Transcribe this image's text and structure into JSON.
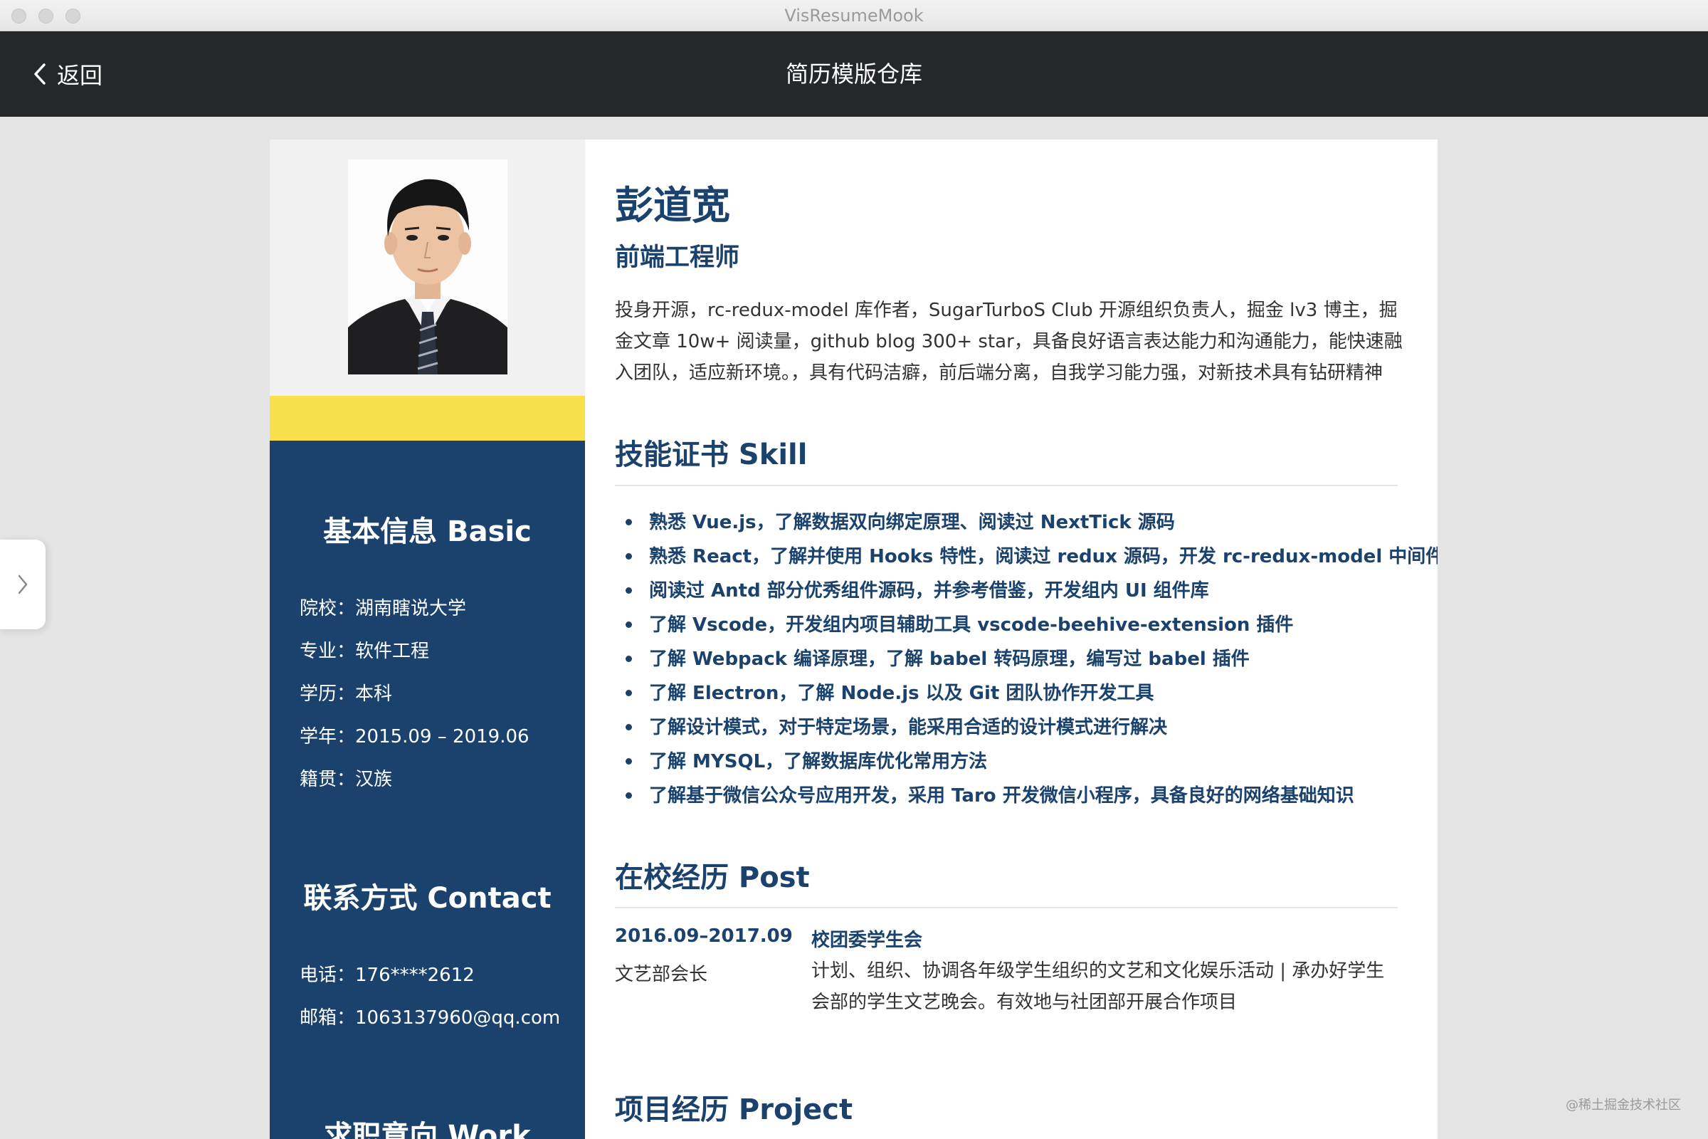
{
  "window": {
    "title": "VisResumeMook"
  },
  "header": {
    "back_label": "返回",
    "title": "简历模版仓库"
  },
  "resume": {
    "name": "彭道宽",
    "job_title": "前端工程师",
    "intro": "投身开源，rc-redux-model 库作者，SugarTurboS Club 开源组织负责人，掘金 lv3 博主，掘金文章 10w+ 阅读量，github blog 300+ star，具备良好语言表达能力和沟通能力，能快速融入团队，适应新环境。，具有代码洁癖，前后端分离，自我学习能力强，对新技术具有钻研精神",
    "basic": {
      "heading": "基本信息 Basic",
      "rows": [
        {
          "text": "院校：湖南瞎说大学"
        },
        {
          "text": "专业：软件工程"
        },
        {
          "text": "学历：本科"
        },
        {
          "text": "学年：2015.09 – 2019.06"
        },
        {
          "text": "籍贯：汉族"
        }
      ]
    },
    "contact": {
      "heading": "联系方式 Contact",
      "rows": [
        {
          "text": "电话：176****2612"
        },
        {
          "text": "邮箱：1063137960@qq.com"
        }
      ]
    },
    "work": {
      "heading": "求职意向 Work"
    },
    "skill": {
      "heading": "技能证书 Skill",
      "items": [
        "熟悉 Vue.js，了解数据双向绑定原理、阅读过 NextTick 源码",
        "熟悉 React，了解并使用 Hooks 特性，阅读过 redux 源码，开发 rc-redux-model 中间件",
        "阅读过 Antd 部分优秀组件源码，并参考借鉴，开发组内 UI 组件库",
        "了解 Vscode，开发组内项目辅助工具 vscode-beehive-extension 插件",
        "了解 Webpack 编译原理，了解 babel 转码原理，编写过 babel 插件",
        "了解 Electron，了解 Node.js 以及 Git 团队协作开发工具",
        "了解设计模式，对于特定场景，能采用合适的设计模式进行解决",
        "了解 MYSQL，了解数据库优化常用方法",
        "了解基于微信公众号应用开发，采用 Taro 开发微信小程序，具备良好的网络基础知识"
      ]
    },
    "post": {
      "heading": "在校经历 Post",
      "date": "2016.09–2017.09",
      "org": "校团委学生会",
      "role": "文艺部会长",
      "desc": "计划、组织、协调各年级学生组织的文艺和文化娱乐活动 | 承办好学生会部的学生文艺晚会。有效地与社团部开展合作项目"
    },
    "project": {
      "heading": "项目经历 Project"
    }
  },
  "watermark": "@稀土掘金技术社区",
  "colors": {
    "navy": "#1b426d",
    "yellow": "#f7e04b",
    "header": "#25272b"
  },
  "icons": {
    "back": "chevron-left-icon",
    "toggle": "chevron-right-icon"
  }
}
